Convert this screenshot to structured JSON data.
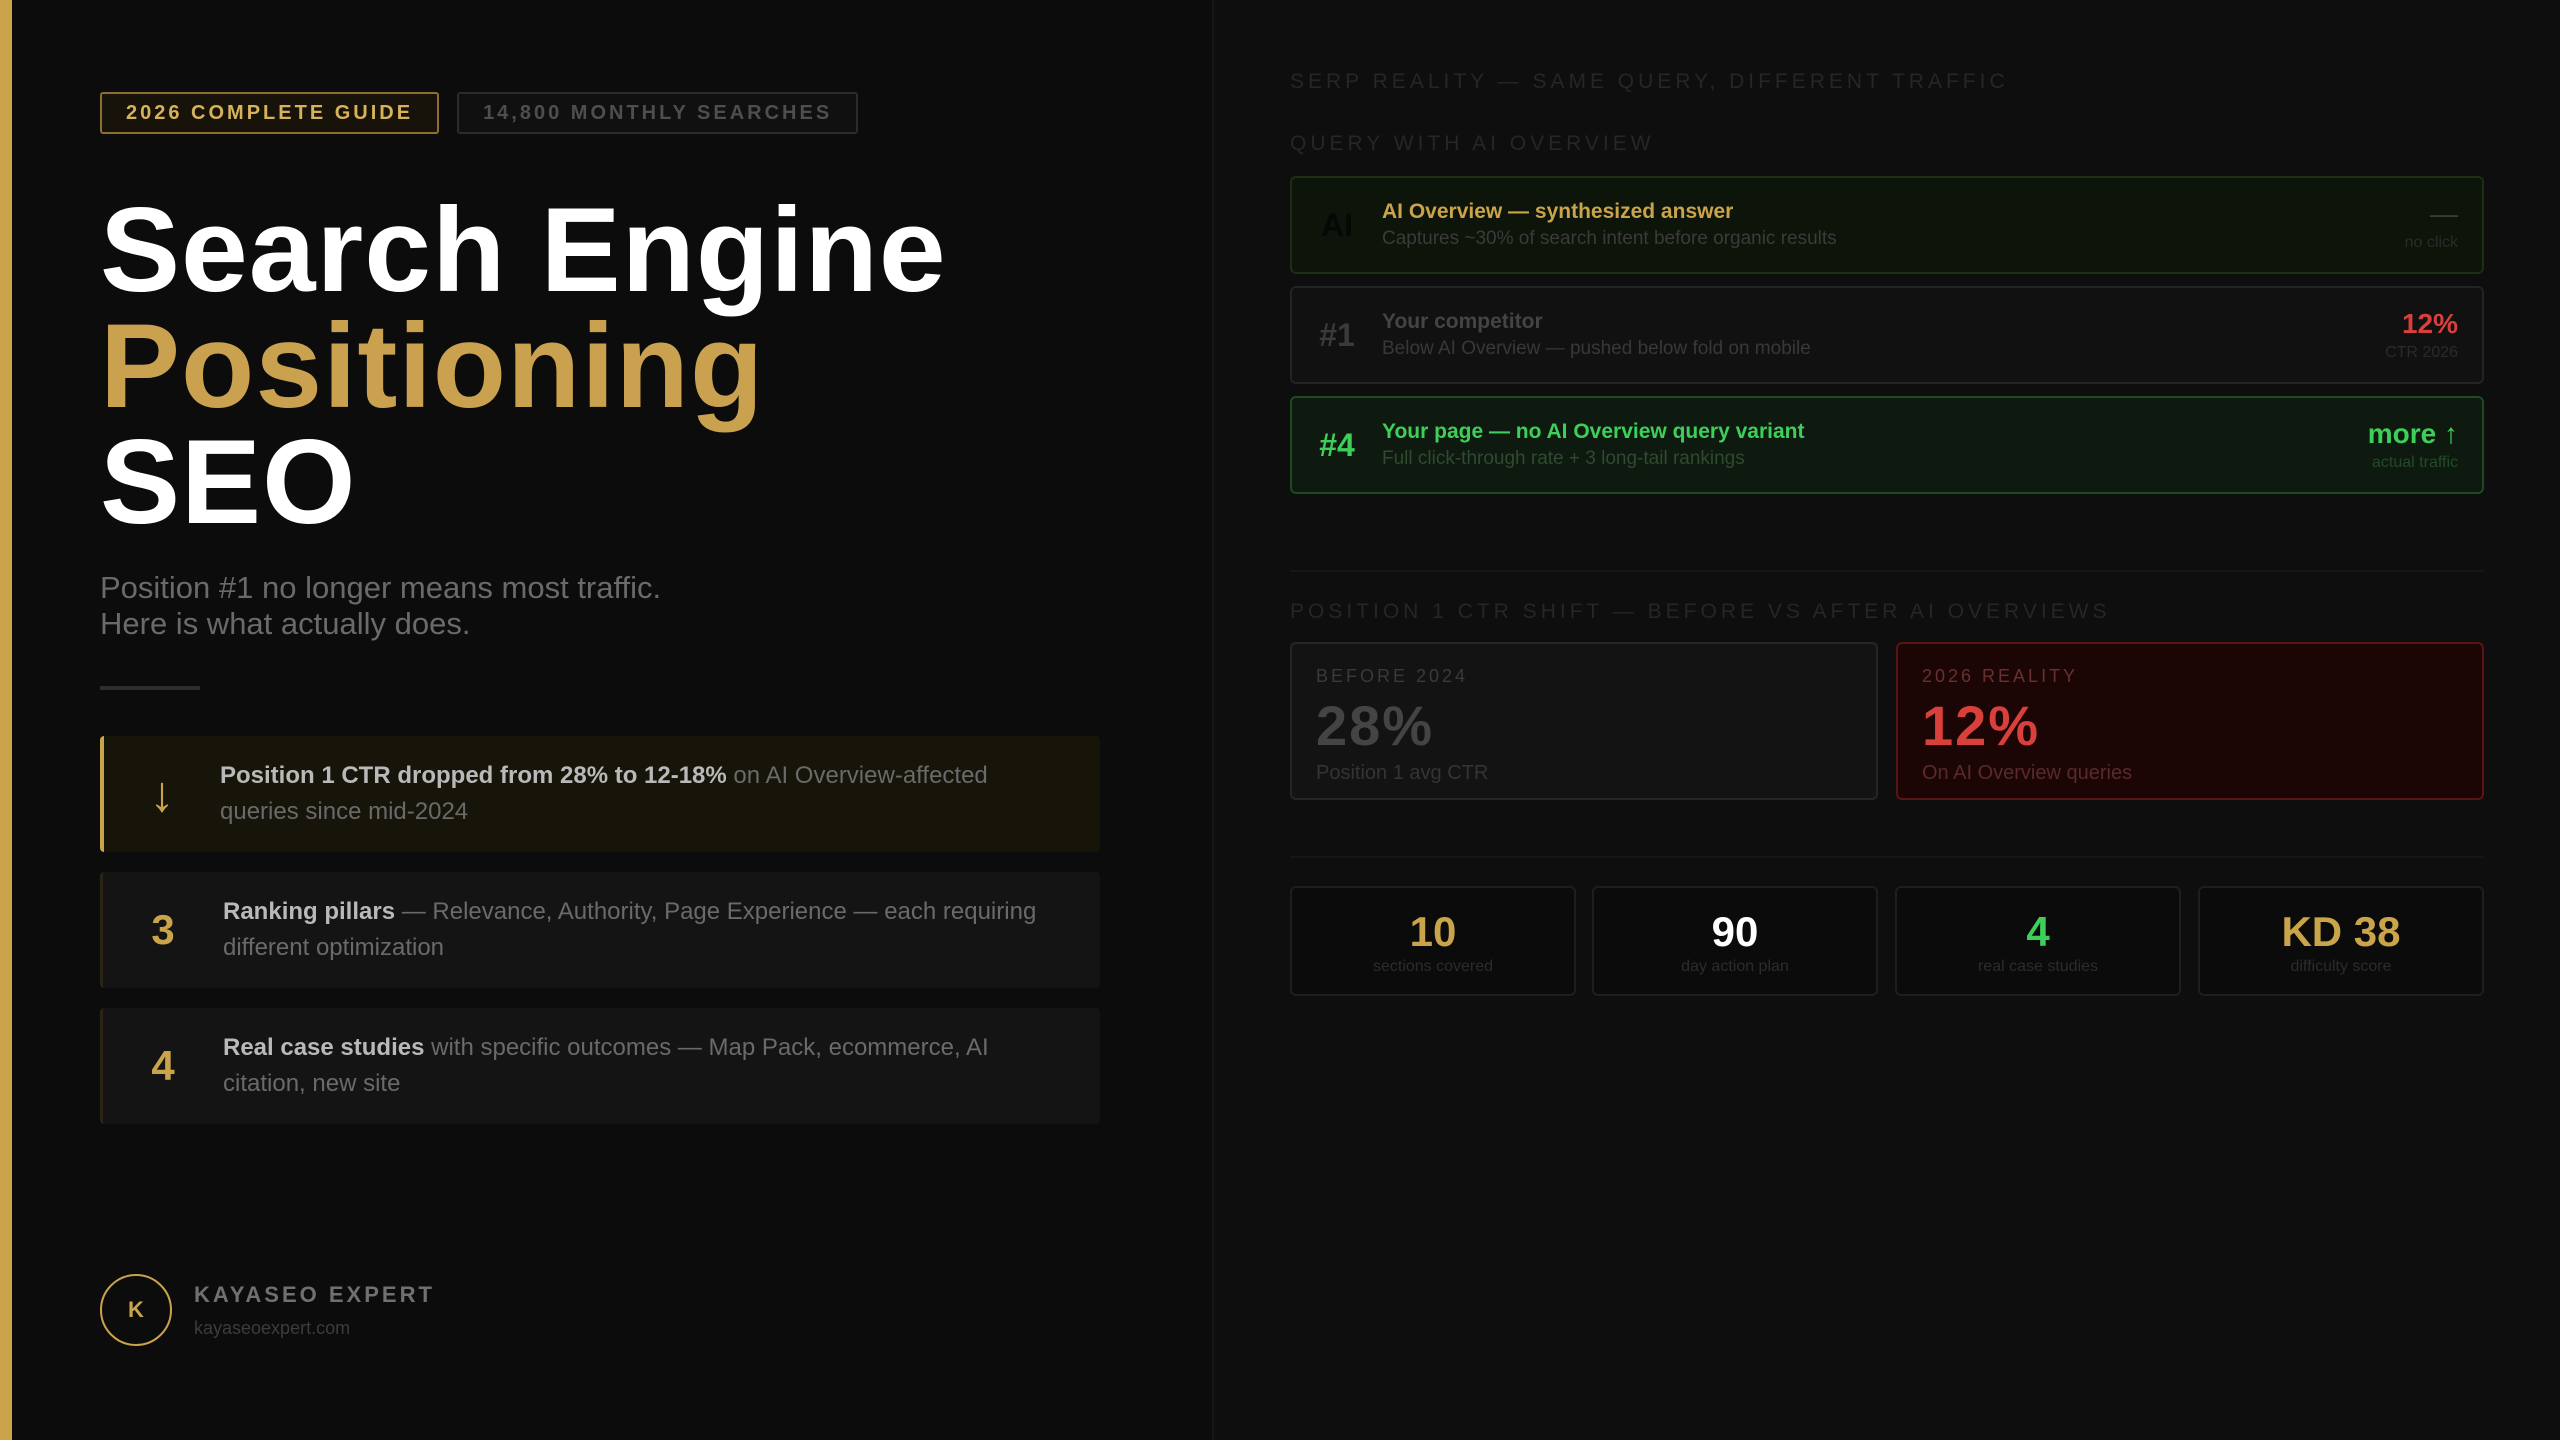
{
  "tags": {
    "guide": "2026 COMPLETE GUIDE",
    "searches": "14,800 MONTHLY SEARCHES"
  },
  "title": {
    "line1": "Search Engine",
    "line2": "Positioning",
    "line3": "SEO"
  },
  "subtitle": {
    "line1": "Position #1 no longer means most traffic.",
    "line2": "Here is what actually does."
  },
  "facts": [
    {
      "icon": "down-arrow-icon",
      "marker": "↓",
      "bold": "Position 1 CTR dropped from 28% to 12-18%",
      "rest": " on AI Overview-affected queries since mid-2024"
    },
    {
      "marker": "3",
      "bold": "Ranking pillars",
      "rest": " — Relevance, Authority, Page Experience — each requiring different optimization"
    },
    {
      "marker": "4",
      "bold": "Real case studies",
      "rest": " with specific outcomes — Map Pack, ecommerce, AI citation, new site"
    }
  ],
  "brand": {
    "logo_letter": "K",
    "name": "KAYASEO EXPERT",
    "url": "kayaseoexpert.com"
  },
  "serp": {
    "section_title": "SERP REALITY — SAME QUERY, DIFFERENT TRAFFIC",
    "query_label": "QUERY WITH AI OVERVIEW",
    "rows": [
      {
        "pos": "AI",
        "title": "AI Overview — synthesized answer",
        "desc": "Captures ~30% of search intent before organic results",
        "value": "—",
        "sub": "no click"
      },
      {
        "pos": "#1",
        "title": "Your competitor",
        "desc": "Below AI Overview — pushed below fold on mobile",
        "value": "12%",
        "sub": "CTR 2026"
      },
      {
        "pos": "#4",
        "title": "Your page — no AI Overview query variant",
        "desc": "Full click-through rate + 3 long-tail rankings",
        "value": "more ↑",
        "sub": "actual traffic"
      }
    ]
  },
  "ctr": {
    "section_title": "POSITION 1 CTR SHIFT — BEFORE VS AFTER AI OVERVIEWS",
    "before": {
      "label": "BEFORE 2024",
      "value": "28%",
      "note": "Position 1 avg CTR"
    },
    "after": {
      "label": "2026 REALITY",
      "value": "12%",
      "note": "On AI Overview queries"
    }
  },
  "stats": [
    {
      "value": "10",
      "label": "sections covered"
    },
    {
      "value": "90",
      "label": "day action plan"
    },
    {
      "value": "4",
      "label": "real case studies"
    },
    {
      "value": "KD 38",
      "label": "difficulty score"
    }
  ],
  "colors": {
    "gold": "#c9a44a",
    "green": "#3ecf5a",
    "red": "#d9403b"
  }
}
